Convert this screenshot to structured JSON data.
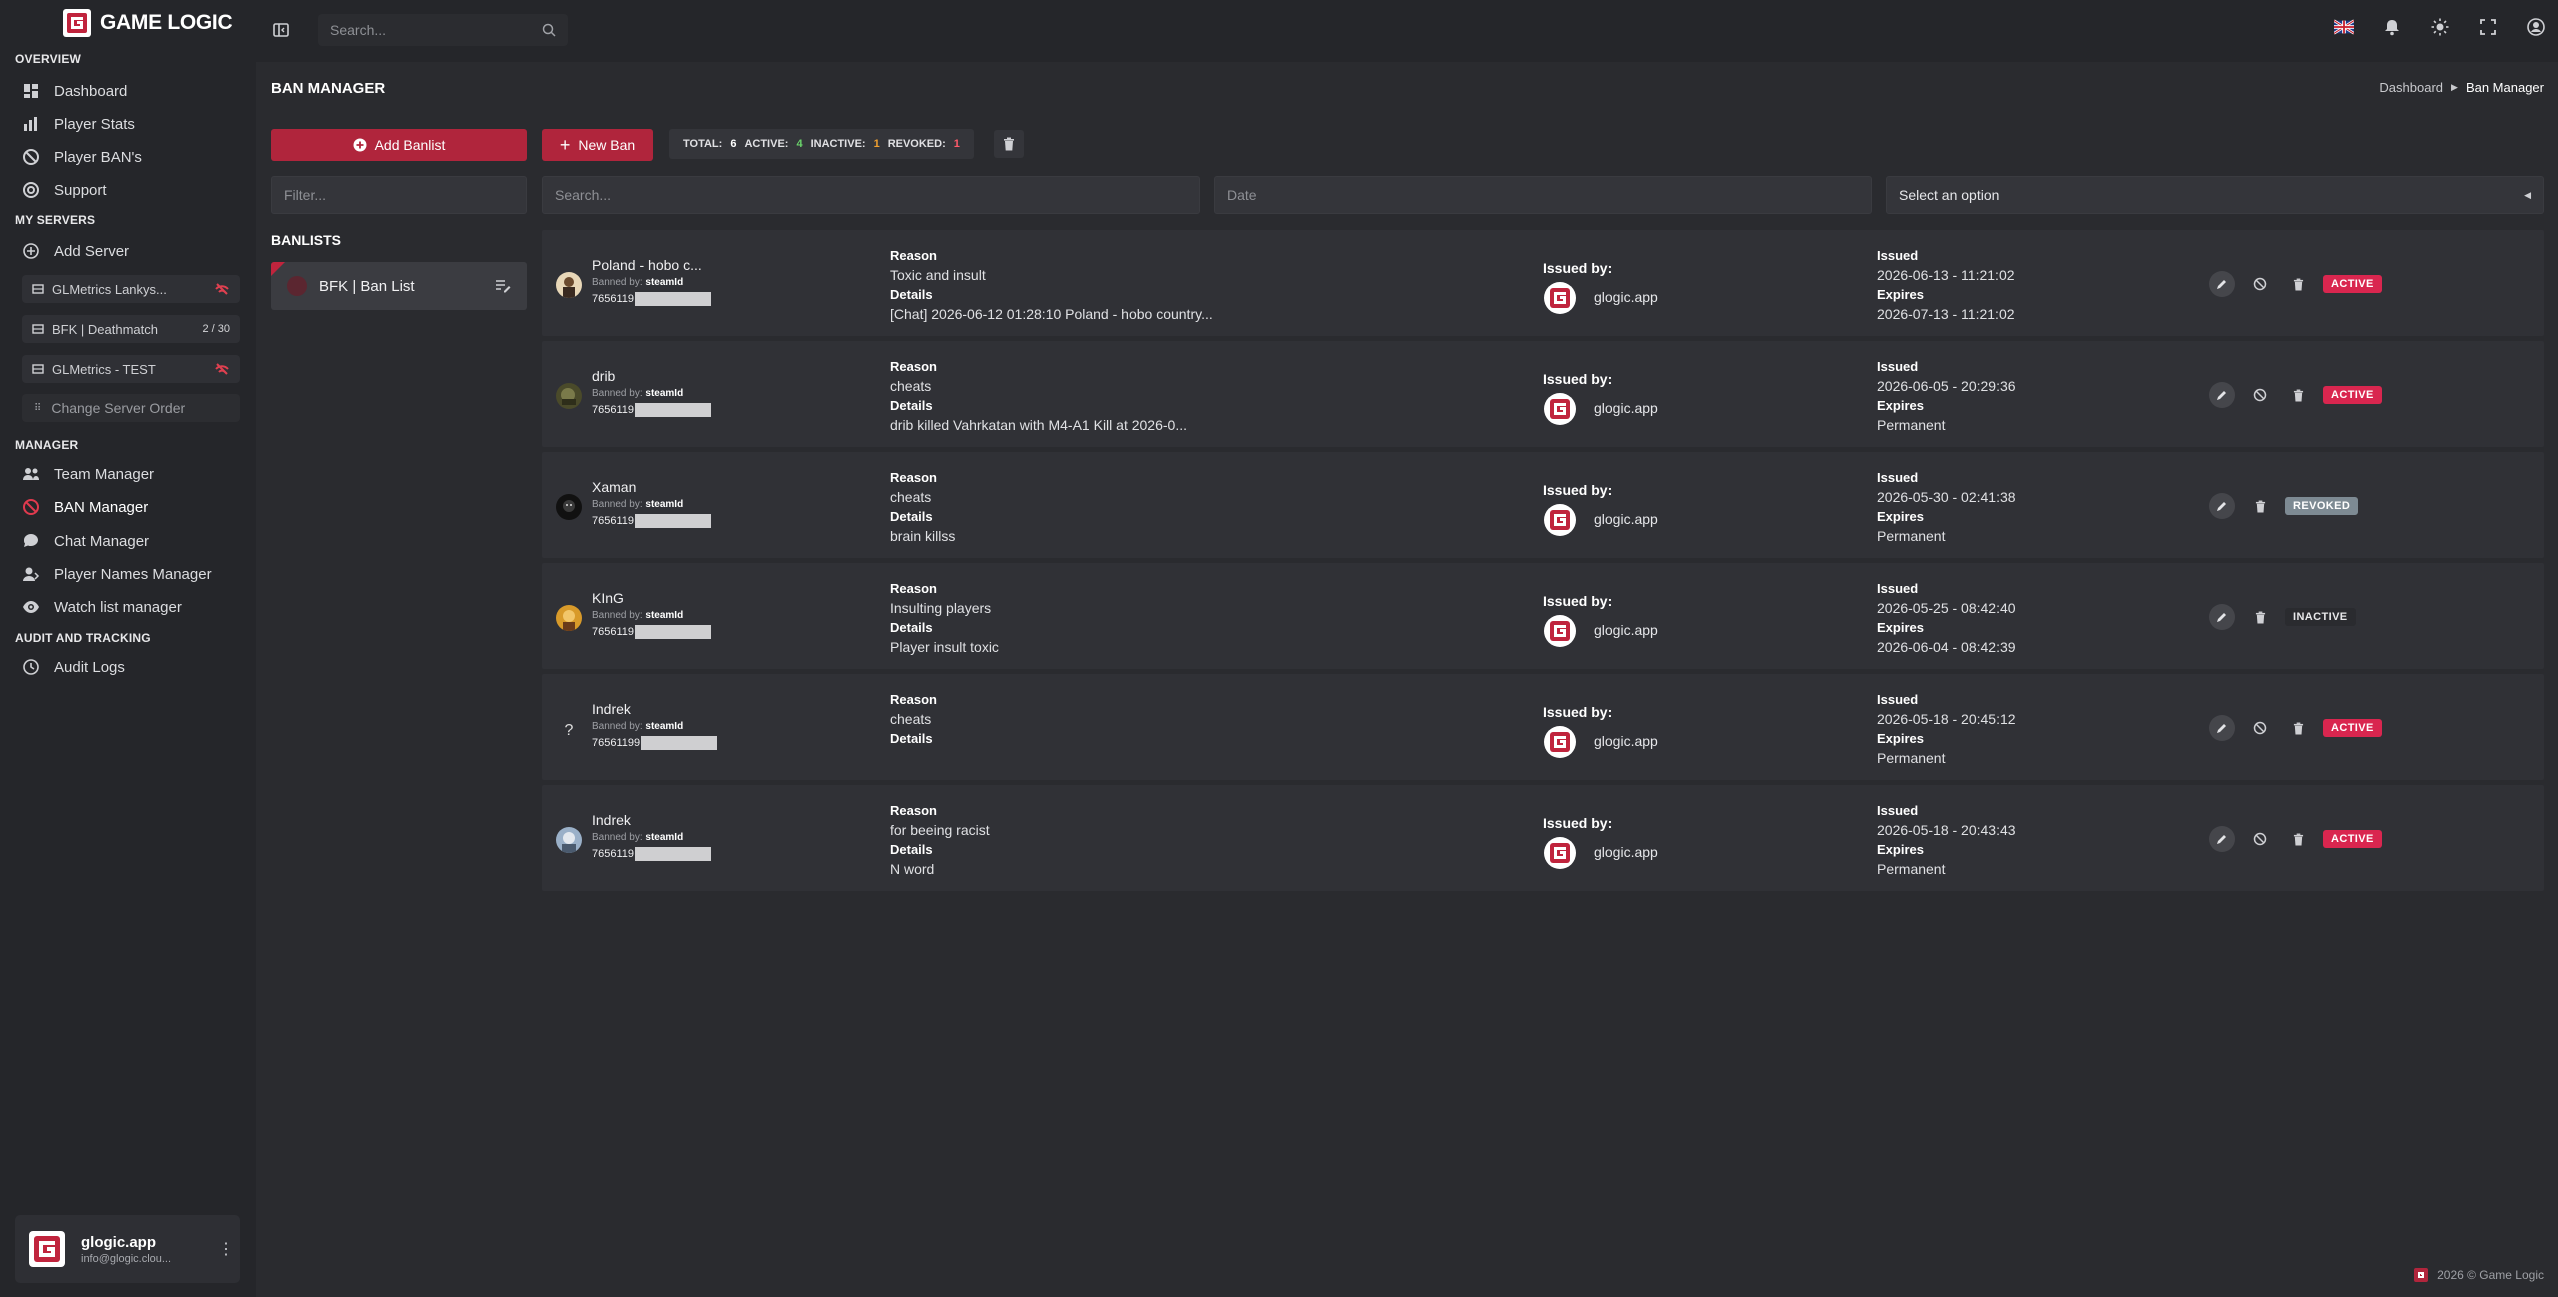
{
  "brand": {
    "name": "GAME LOGIC"
  },
  "topbar": {
    "search_placeholder": "Search..."
  },
  "sidebar": {
    "overview_title": "OVERVIEW",
    "overview": [
      {
        "label": "Dashboard"
      },
      {
        "label": "Player Stats"
      },
      {
        "label": "Player BAN's"
      },
      {
        "label": "Support"
      }
    ],
    "servers_title": "MY SERVERS",
    "add_server": "Add Server",
    "servers": [
      {
        "label": "GLMetrics Lankys...",
        "badge": ""
      },
      {
        "label": "BFK | Deathmatch",
        "badge": "2 / 30"
      },
      {
        "label": "GLMetrics - TEST",
        "badge": ""
      }
    ],
    "change_order": "Change Server Order",
    "manager_title": "MANAGER",
    "manager": [
      {
        "label": "Team Manager"
      },
      {
        "label": "BAN Manager"
      },
      {
        "label": "Chat Manager"
      },
      {
        "label": "Player Names Manager"
      },
      {
        "label": "Watch list manager"
      }
    ],
    "audit_title": "AUDIT AND TRACKING",
    "audit": [
      {
        "label": "Audit Logs"
      }
    ],
    "user": {
      "name": "glogic.app",
      "email": "info@glogic.clou..."
    }
  },
  "page": {
    "title": "BAN MANAGER",
    "breadcrumb": [
      "Dashboard",
      "Ban Manager"
    ],
    "add_banlist": "Add Banlist",
    "new_ban": "New Ban",
    "stats": {
      "total_label": "TOTAL:",
      "total": "6",
      "active_label": "ACTIVE:",
      "active": "4",
      "inactive_label": "INACTIVE:",
      "inactive": "1",
      "revoked_label": "REVOKED:",
      "revoked": "1"
    },
    "filter_placeholder": "Filter...",
    "search_placeholder": "Search...",
    "date_placeholder": "Date",
    "select_value": "Select an option",
    "banlists_title": "BANLISTS",
    "banlist_item": "BFK | Ban List"
  },
  "labels": {
    "reason": "Reason",
    "details": "Details",
    "issued_by": "Issued by:",
    "issued": "Issued",
    "expires": "Expires",
    "banned_by": "Banned by:"
  },
  "bans": [
    {
      "name": "Poland - hobo c...",
      "banned_by": "steamId",
      "sid": "7656119",
      "reason": "Toxic and insult",
      "details": "[Chat] 2026-06-12 01:28:10 Poland - hobo country...",
      "issuer": "glogic.app",
      "issued": "2026-06-13 - 11:21:02",
      "expires": "2026-07-13 - 11:21:02",
      "status": "ACTIVE",
      "avatar": "p1"
    },
    {
      "name": "drib",
      "banned_by": "steamId",
      "sid": "7656119",
      "reason": "cheats",
      "details": "drib killed Vahrkatan with M4-A1 Kill at 2026-0...",
      "issuer": "glogic.app",
      "issued": "2026-06-05 - 20:29:36",
      "expires": "Permanent",
      "status": "ACTIVE",
      "avatar": "p2"
    },
    {
      "name": "Xaman",
      "banned_by": "steamId",
      "sid": "7656119",
      "reason": "cheats",
      "details": "brain killss",
      "issuer": "glogic.app",
      "issued": "2026-05-30 - 02:41:38",
      "expires": "Permanent",
      "status": "REVOKED",
      "avatar": "p3"
    },
    {
      "name": "KInG",
      "banned_by": "steamId",
      "sid": "7656119",
      "reason": "Insulting players",
      "details": "Player insult toxic",
      "issuer": "glogic.app",
      "issued": "2026-05-25 - 08:42:40",
      "expires": "2026-06-04 - 08:42:39",
      "status": "INACTIVE",
      "avatar": "p4"
    },
    {
      "name": "Indrek",
      "banned_by": "steamId",
      "sid": "76561199",
      "reason": "cheats",
      "details": "",
      "issuer": "glogic.app",
      "issued": "2026-05-18 - 20:45:12",
      "expires": "Permanent",
      "status": "ACTIVE",
      "avatar": "p5"
    },
    {
      "name": "Indrek",
      "banned_by": "steamId",
      "sid": "7656119",
      "reason": "for beeing racist",
      "details": "N word",
      "issuer": "glogic.app",
      "issued": "2026-05-18 - 20:43:43",
      "expires": "Permanent",
      "status": "ACTIVE",
      "avatar": "p6"
    }
  ],
  "footer": {
    "text": "2026 © Game Logic"
  },
  "colors": {
    "accent": "#b0253c",
    "active": "#d9264f",
    "revoked": "#7d8a93",
    "green": "#6ad36b"
  }
}
